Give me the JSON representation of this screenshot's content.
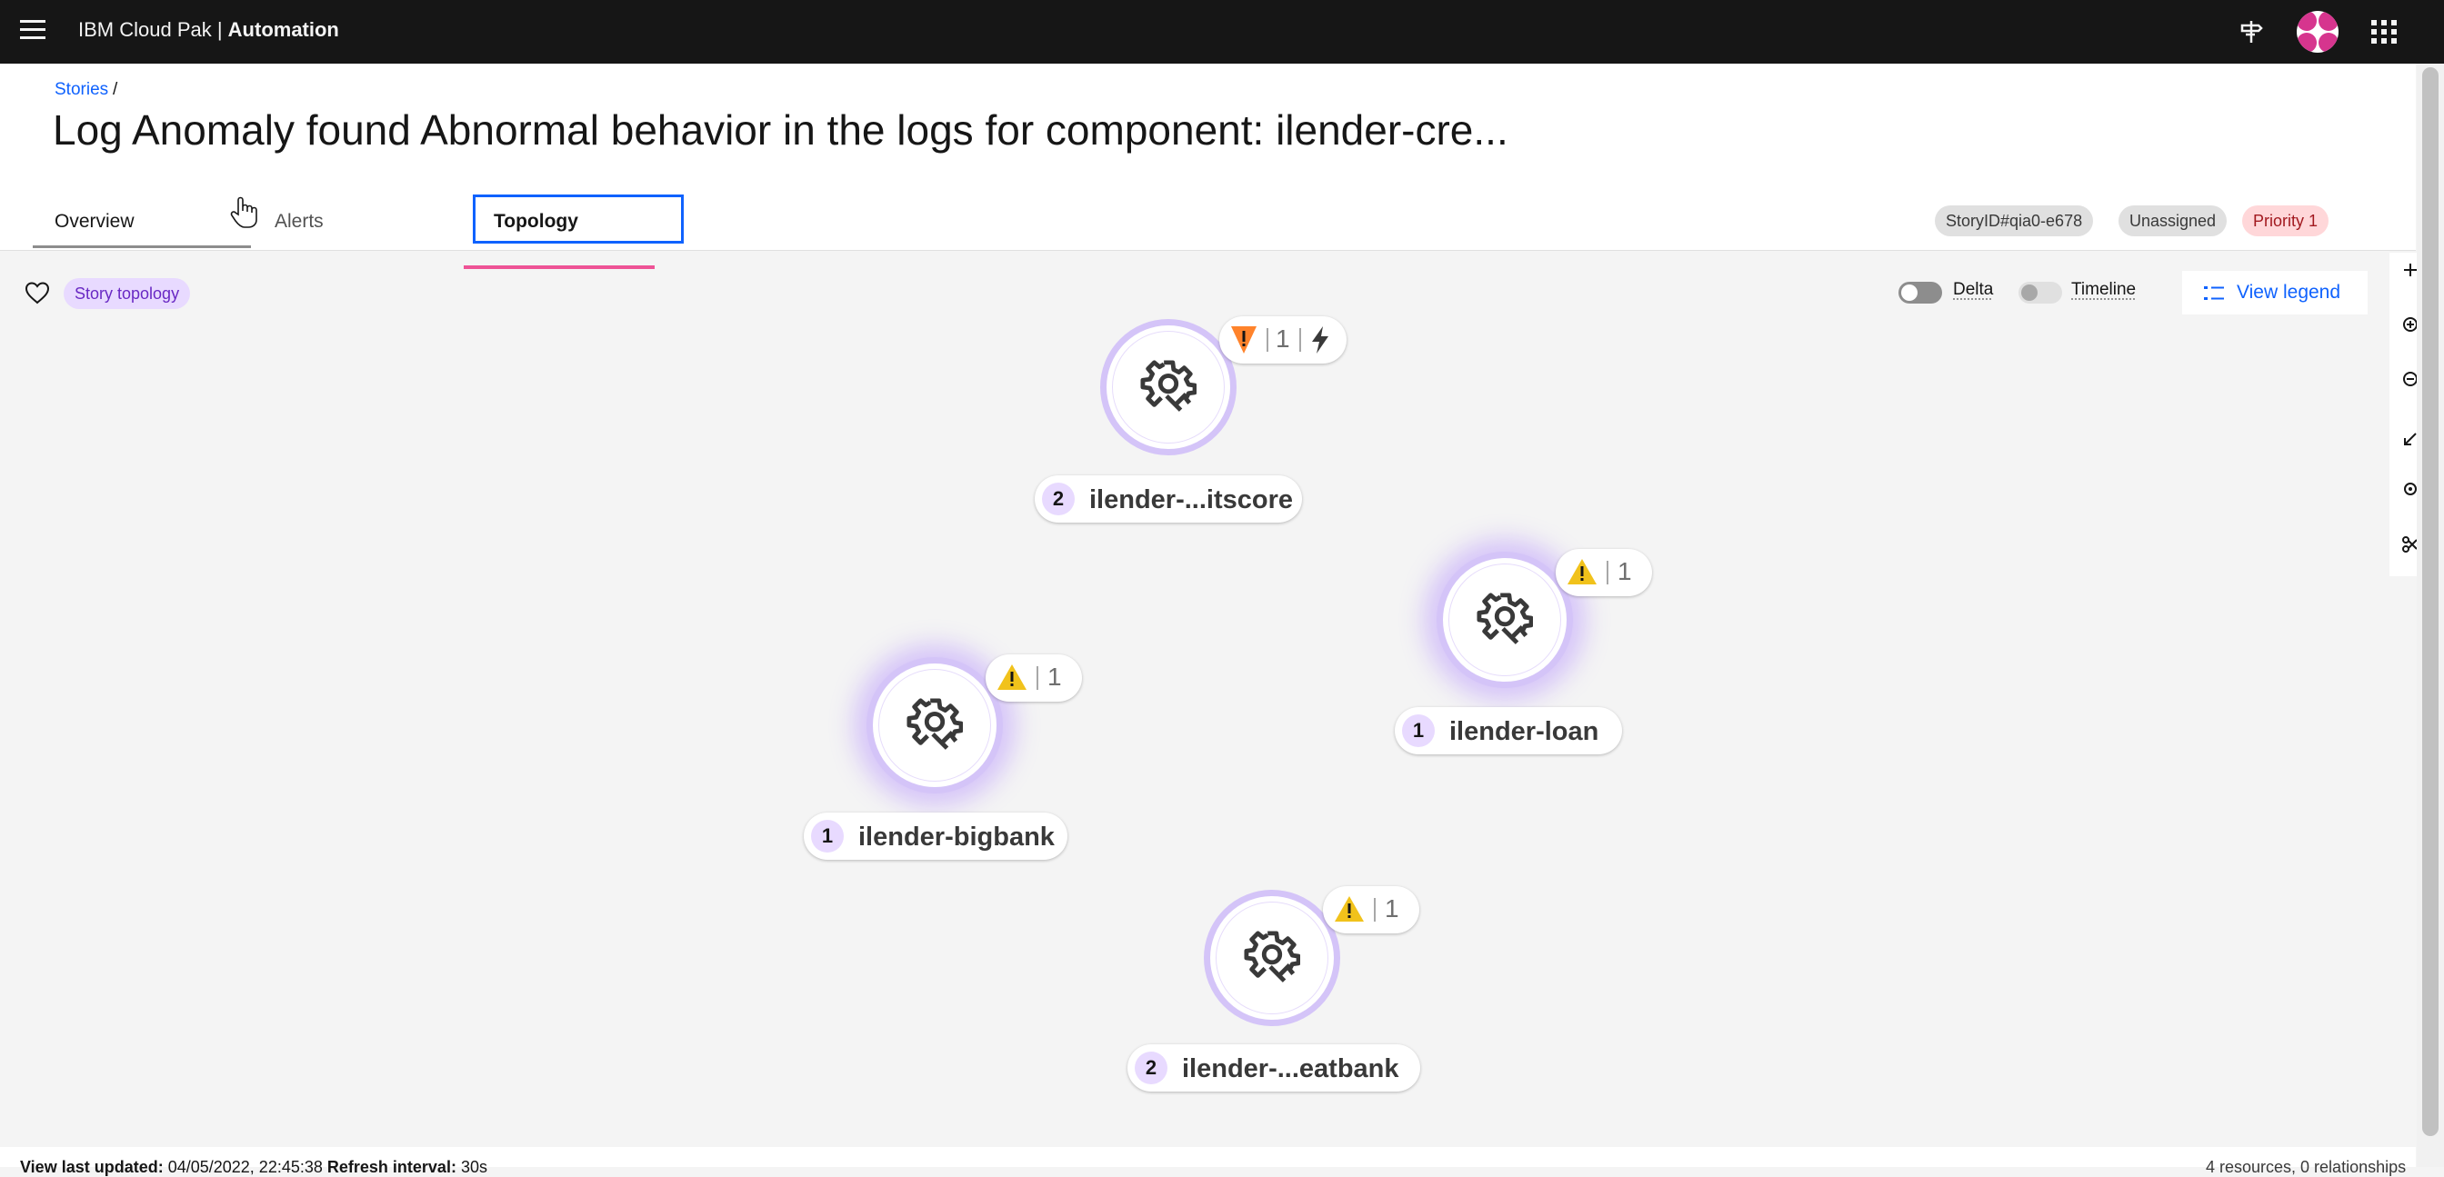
{
  "app": {
    "brand_prefix": "IBM Cloud Pak | ",
    "brand_name": "Automation"
  },
  "breadcrumb": {
    "stories": "Stories",
    "separator": "/"
  },
  "page_title": "Log Anomaly found Abnormal behavior in the logs for component: ilender-cre...",
  "tabs": [
    {
      "label": "Overview"
    },
    {
      "label": "Alerts"
    },
    {
      "label": "Topology",
      "selected": true
    }
  ],
  "tags": {
    "story_id": "StoryID#qia0-e678",
    "assignee": "Unassigned",
    "priority": "Priority 1"
  },
  "toolbar": {
    "story_topology": "Story topology",
    "delta_label": "Delta",
    "timeline_label": "Timeline",
    "view_legend": "View legend"
  },
  "nodes": [
    {
      "name": "ilender-...itscore",
      "group_count": "2",
      "alert_count": "1",
      "alert_severity": "major",
      "has_event": true
    },
    {
      "name": "ilender-loan",
      "group_count": "1",
      "alert_count": "1",
      "alert_severity": "warning",
      "highlighted": true
    },
    {
      "name": "ilender-bigbank",
      "group_count": "1",
      "alert_count": "1",
      "alert_severity": "warning",
      "highlighted": true
    },
    {
      "name": "ilender-...eatbank",
      "group_count": "2",
      "alert_count": "1",
      "alert_severity": "warning"
    }
  ],
  "footer": {
    "last_updated_label": "View last updated:",
    "last_updated_value": "04/05/2022, 22:45:38",
    "refresh_label": "Refresh interval:",
    "refresh_value": "30s",
    "summary": "4 resources, 0 relationships"
  },
  "colors": {
    "accent": "#0f62fe",
    "tab_indicator": "#ee5396",
    "node_ring": "#d4c4f8",
    "warning": "#f1c21b",
    "major": "#ff832b"
  }
}
